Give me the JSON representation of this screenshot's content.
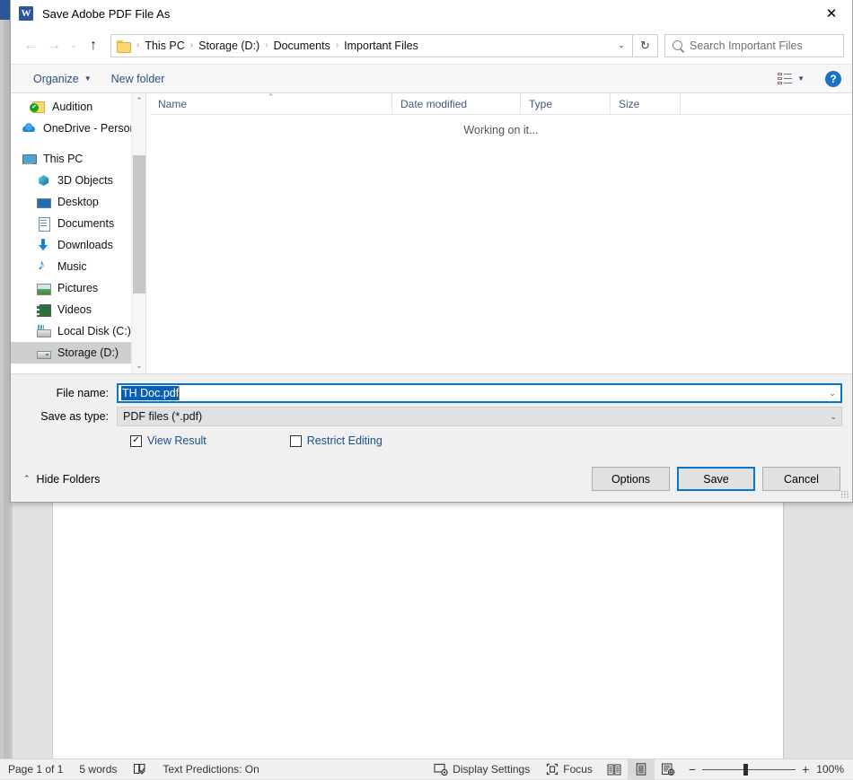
{
  "dialog": {
    "title": "Save Adobe PDF File As",
    "close_label": "✕",
    "app_icon_letter": "W",
    "nav": {
      "back": "←",
      "forward": "→",
      "recent": "⌄",
      "up": "↑",
      "refresh": "↻",
      "address_dropdown": "⌄"
    },
    "breadcrumb": {
      "separator": "›",
      "items": [
        "This PC",
        "Storage (D:)",
        "Documents",
        "Important Files"
      ]
    },
    "search": {
      "placeholder": "Search Important Files",
      "icon": "search-icon"
    },
    "commandbar": {
      "organize": "Organize",
      "organize_caret": "▼",
      "new_folder": "New folder",
      "view_caret": "▼",
      "help": "?"
    },
    "sidebar": {
      "items": [
        {
          "label": "Audition",
          "icon": "folder-check-icon",
          "indent": 22,
          "selected": false
        },
        {
          "label": "OneDrive - Personal",
          "icon": "cloud-icon",
          "indent": 12,
          "selected": false
        },
        {
          "label": "This PC",
          "icon": "computer-icon",
          "indent": 12,
          "selected": false
        },
        {
          "label": "3D Objects",
          "icon": "cube-icon",
          "indent": 28,
          "selected": false
        },
        {
          "label": "Desktop",
          "icon": "desktop-icon",
          "indent": 28,
          "selected": false
        },
        {
          "label": "Documents",
          "icon": "document-icon",
          "indent": 28,
          "selected": false
        },
        {
          "label": "Downloads",
          "icon": "download-arrow-icon",
          "indent": 28,
          "selected": false
        },
        {
          "label": "Music",
          "icon": "music-note-icon",
          "indent": 28,
          "selected": false
        },
        {
          "label": "Pictures",
          "icon": "picture-icon",
          "indent": 28,
          "selected": false
        },
        {
          "label": "Videos",
          "icon": "video-icon",
          "indent": 28,
          "selected": false
        },
        {
          "label": "Local Disk (C:)",
          "icon": "local-disk-icon",
          "indent": 28,
          "selected": false
        },
        {
          "label": "Storage (D:)",
          "icon": "drive-icon",
          "indent": 28,
          "selected": true
        }
      ],
      "scroll_up": "⌃",
      "scroll_down": "⌄"
    },
    "filelist": {
      "columns": [
        {
          "label": "Name",
          "sorted": true,
          "sort_caret": "⌃"
        },
        {
          "label": "Date modified",
          "sorted": false
        },
        {
          "label": "Type",
          "sorted": false
        },
        {
          "label": "Size",
          "sorted": false
        }
      ],
      "rows": [],
      "status_text": "Working on it..."
    },
    "form": {
      "filename_label": "File name:",
      "filename_value": "TH Doc.pdf",
      "filename_selected": true,
      "savetype_label": "Save as type:",
      "savetype_value": "PDF files (*.pdf)",
      "combo_arrow": "⌄",
      "checkboxes": [
        {
          "label": "View Result",
          "checked": true,
          "mark": "✓"
        },
        {
          "label": "Restrict Editing",
          "checked": false,
          "mark": ""
        }
      ]
    },
    "footer": {
      "hide_folders_caret": "⌃",
      "hide_folders": "Hide Folders",
      "buttons": [
        {
          "label": "Options",
          "primary": false
        },
        {
          "label": "Save",
          "primary": true
        },
        {
          "label": "Cancel",
          "primary": false
        }
      ]
    }
  },
  "word": {
    "status_bar": {
      "page": "Page 1 of 1",
      "words": "5 words",
      "proofing_icon": "proofing-icon",
      "text_predictions": "Text Predictions: On",
      "display_settings": "Display Settings",
      "focus": "Focus",
      "views": [
        {
          "name": "read-mode",
          "glyph": "read",
          "active": false
        },
        {
          "name": "print-layout",
          "glyph": "print",
          "active": true
        },
        {
          "name": "web-layout",
          "glyph": "web",
          "active": false
        }
      ],
      "zoom_out": "−",
      "zoom_in": "+",
      "zoom_level": "100%"
    }
  },
  "colors": {
    "accent": "#0078d7",
    "word_blue": "#2b579a",
    "link_blue": "#1b4f8a",
    "selection_blue": "#0b5fb3",
    "folder_yellow": "#fcd672"
  }
}
